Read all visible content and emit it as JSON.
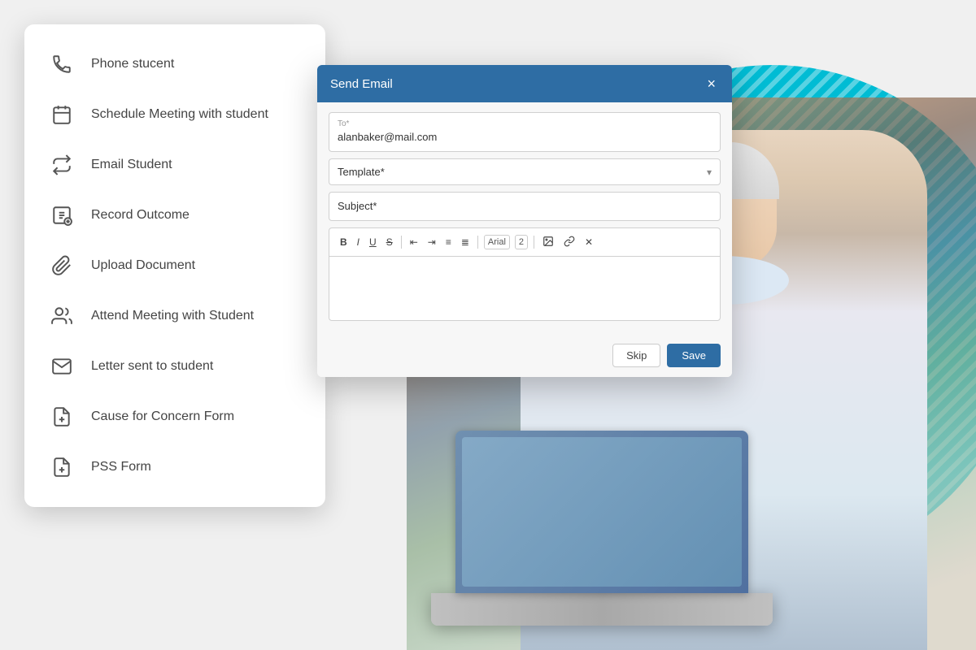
{
  "background": {
    "teal_color": "#00bcd4"
  },
  "sidebar": {
    "items": [
      {
        "id": "phone-student",
        "label": "Phone stucent",
        "icon": "phone"
      },
      {
        "id": "schedule-meeting",
        "label": "Schedule Meeting with student",
        "icon": "calendar"
      },
      {
        "id": "email-student",
        "label": "Email Student",
        "icon": "email-forward"
      },
      {
        "id": "record-outcome",
        "label": "Record Outcome",
        "icon": "record"
      },
      {
        "id": "upload-document",
        "label": "Upload Document",
        "icon": "paperclip"
      },
      {
        "id": "attend-meeting",
        "label": "Attend Meeting with Student",
        "icon": "group"
      },
      {
        "id": "letter-sent",
        "label": "Letter sent to student",
        "icon": "envelope"
      },
      {
        "id": "concern-form",
        "label": "Cause for Concern Form",
        "icon": "doc-plus"
      },
      {
        "id": "pss-form",
        "label": "PSS Form",
        "icon": "doc-plus2"
      }
    ]
  },
  "modal": {
    "title": "Send Email",
    "close_label": "×",
    "to_label": "To*",
    "to_value": "alanbaker@mail.com",
    "template_label": "Template*",
    "subject_label": "Subject*",
    "toolbar": {
      "bold": "B",
      "italic": "I",
      "underline": "U",
      "strikethrough": "S",
      "indent_left": "«",
      "indent_right": "»",
      "list_ul": "≡",
      "list_ol": "≣",
      "font_name": "Arial",
      "font_size": "2"
    },
    "footer": {
      "skip_label": "Skip",
      "save_label": "Save"
    }
  }
}
